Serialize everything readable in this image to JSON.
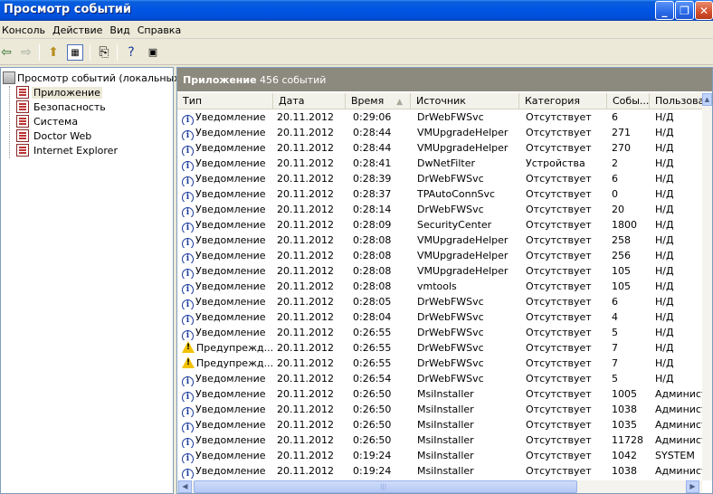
{
  "window": {
    "title": "Просмотр событий"
  },
  "menu": [
    "Консоль",
    "Действие",
    "Вид",
    "Справка"
  ],
  "tree": {
    "root": "Просмотр событий (локальных)",
    "children": [
      "Приложение",
      "Безопасность",
      "Система",
      "Doctor Web",
      "Internet Explorer"
    ],
    "selected": 0
  },
  "pane": {
    "name": "Приложение",
    "count": "456 событий"
  },
  "columns": [
    "Тип",
    "Дата",
    "Время",
    "Источник",
    "Категория",
    "Собы...",
    "Пользова..."
  ],
  "rows": [
    {
      "icon": "info",
      "type": "Уведомление",
      "date": "20.11.2012",
      "time": "0:29:06",
      "source": "DrWebFWSvc",
      "category": "Отсутствует",
      "event": "6",
      "user": "Н/Д"
    },
    {
      "icon": "info",
      "type": "Уведомление",
      "date": "20.11.2012",
      "time": "0:28:44",
      "source": "VMUpgradeHelper",
      "category": "Отсутствует",
      "event": "271",
      "user": "Н/Д"
    },
    {
      "icon": "info",
      "type": "Уведомление",
      "date": "20.11.2012",
      "time": "0:28:44",
      "source": "VMUpgradeHelper",
      "category": "Отсутствует",
      "event": "270",
      "user": "Н/Д"
    },
    {
      "icon": "info",
      "type": "Уведомление",
      "date": "20.11.2012",
      "time": "0:28:41",
      "source": "DwNetFilter",
      "category": "Устройства",
      "event": "2",
      "user": "Н/Д"
    },
    {
      "icon": "info",
      "type": "Уведомление",
      "date": "20.11.2012",
      "time": "0:28:39",
      "source": "DrWebFWSvc",
      "category": "Отсутствует",
      "event": "6",
      "user": "Н/Д"
    },
    {
      "icon": "info",
      "type": "Уведомление",
      "date": "20.11.2012",
      "time": "0:28:37",
      "source": "TPAutoConnSvc",
      "category": "Отсутствует",
      "event": "0",
      "user": "Н/Д"
    },
    {
      "icon": "info",
      "type": "Уведомление",
      "date": "20.11.2012",
      "time": "0:28:14",
      "source": "DrWebFWSvc",
      "category": "Отсутствует",
      "event": "20",
      "user": "Н/Д"
    },
    {
      "icon": "info",
      "type": "Уведомление",
      "date": "20.11.2012",
      "time": "0:28:09",
      "source": "SecurityCenter",
      "category": "Отсутствует",
      "event": "1800",
      "user": "Н/Д"
    },
    {
      "icon": "info",
      "type": "Уведомление",
      "date": "20.11.2012",
      "time": "0:28:08",
      "source": "VMUpgradeHelper",
      "category": "Отсутствует",
      "event": "258",
      "user": "Н/Д"
    },
    {
      "icon": "info",
      "type": "Уведомление",
      "date": "20.11.2012",
      "time": "0:28:08",
      "source": "VMUpgradeHelper",
      "category": "Отсутствует",
      "event": "256",
      "user": "Н/Д"
    },
    {
      "icon": "info",
      "type": "Уведомление",
      "date": "20.11.2012",
      "time": "0:28:08",
      "source": "VMUpgradeHelper",
      "category": "Отсутствует",
      "event": "105",
      "user": "Н/Д"
    },
    {
      "icon": "info",
      "type": "Уведомление",
      "date": "20.11.2012",
      "time": "0:28:08",
      "source": "vmtools",
      "category": "Отсутствует",
      "event": "105",
      "user": "Н/Д"
    },
    {
      "icon": "info",
      "type": "Уведомление",
      "date": "20.11.2012",
      "time": "0:28:05",
      "source": "DrWebFWSvc",
      "category": "Отсутствует",
      "event": "6",
      "user": "Н/Д"
    },
    {
      "icon": "info",
      "type": "Уведомление",
      "date": "20.11.2012",
      "time": "0:28:04",
      "source": "DrWebFWSvc",
      "category": "Отсутствует",
      "event": "4",
      "user": "Н/Д"
    },
    {
      "icon": "info",
      "type": "Уведомление",
      "date": "20.11.2012",
      "time": "0:26:55",
      "source": "DrWebFWSvc",
      "category": "Отсутствует",
      "event": "5",
      "user": "Н/Д"
    },
    {
      "icon": "warn",
      "type": "Предупрежд...",
      "date": "20.11.2012",
      "time": "0:26:55",
      "source": "DrWebFWSvc",
      "category": "Отсутствует",
      "event": "7",
      "user": "Н/Д"
    },
    {
      "icon": "warn",
      "type": "Предупрежд...",
      "date": "20.11.2012",
      "time": "0:26:55",
      "source": "DrWebFWSvc",
      "category": "Отсутствует",
      "event": "7",
      "user": "Н/Д"
    },
    {
      "icon": "info",
      "type": "Уведомление",
      "date": "20.11.2012",
      "time": "0:26:54",
      "source": "DrWebFWSvc",
      "category": "Отсутствует",
      "event": "5",
      "user": "Н/Д"
    },
    {
      "icon": "info",
      "type": "Уведомление",
      "date": "20.11.2012",
      "time": "0:26:50",
      "source": "MsiInstaller",
      "category": "Отсутствует",
      "event": "1005",
      "user": "Админист"
    },
    {
      "icon": "info",
      "type": "Уведомление",
      "date": "20.11.2012",
      "time": "0:26:50",
      "source": "MsiInstaller",
      "category": "Отсутствует",
      "event": "1038",
      "user": "Админист"
    },
    {
      "icon": "info",
      "type": "Уведомление",
      "date": "20.11.2012",
      "time": "0:26:50",
      "source": "MsiInstaller",
      "category": "Отсутствует",
      "event": "1035",
      "user": "Админист"
    },
    {
      "icon": "info",
      "type": "Уведомление",
      "date": "20.11.2012",
      "time": "0:26:50",
      "source": "MsiInstaller",
      "category": "Отсутствует",
      "event": "11728",
      "user": "Админист"
    },
    {
      "icon": "info",
      "type": "Уведомление",
      "date": "20.11.2012",
      "time": "0:19:24",
      "source": "MsiInstaller",
      "category": "Отсутствует",
      "event": "1042",
      "user": "SYSTEM"
    },
    {
      "icon": "info",
      "type": "Уведомление",
      "date": "20.11.2012",
      "time": "0:19:24",
      "source": "MsiInstaller",
      "category": "Отсутствует",
      "event": "1038",
      "user": "Админист"
    }
  ]
}
